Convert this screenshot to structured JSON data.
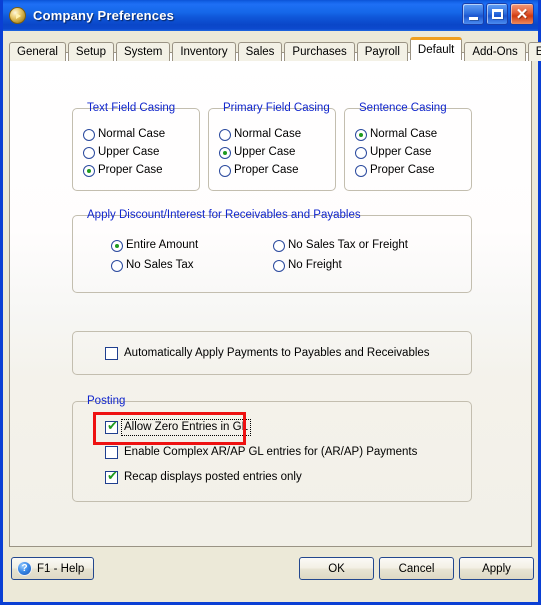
{
  "window": {
    "title": "Company Preferences",
    "icon": "app-circle-icon",
    "controls": {
      "minimize": "minimize-icon",
      "maximize": "maximize-icon",
      "close": "close-icon"
    }
  },
  "tabs": [
    {
      "label": "General",
      "active": false
    },
    {
      "label": "Setup",
      "active": false
    },
    {
      "label": "System",
      "active": false
    },
    {
      "label": "Inventory",
      "active": false
    },
    {
      "label": "Sales",
      "active": false
    },
    {
      "label": "Purchases",
      "active": false
    },
    {
      "label": "Payroll",
      "active": false
    },
    {
      "label": "Default",
      "active": true
    },
    {
      "label": "Add-Ons",
      "active": false
    },
    {
      "label": "Email Setup",
      "active": false
    }
  ],
  "groups": {
    "text_field_casing": {
      "label": "Text Field Casing",
      "options": [
        {
          "label": "Normal Case",
          "selected": false
        },
        {
          "label": "Upper Case",
          "selected": false
        },
        {
          "label": "Proper Case",
          "selected": true
        }
      ]
    },
    "primary_field_casing": {
      "label": "Primary Field Casing",
      "options": [
        {
          "label": "Normal Case",
          "selected": false
        },
        {
          "label": "Upper Case",
          "selected": true
        },
        {
          "label": "Proper Case",
          "selected": false
        }
      ]
    },
    "sentence_casing": {
      "label": "Sentence Casing",
      "options": [
        {
          "label": "Normal Case",
          "selected": true
        },
        {
          "label": "Upper Case",
          "selected": false
        },
        {
          "label": "Proper Case",
          "selected": false
        }
      ]
    },
    "apply_discount": {
      "label": "Apply Discount/Interest for Receivables and Payables",
      "options_left": [
        {
          "label": "Entire Amount",
          "selected": true
        },
        {
          "label": "No Sales Tax",
          "selected": false
        }
      ],
      "options_right": [
        {
          "label": "No Sales Tax or Freight",
          "selected": false
        },
        {
          "label": "No Freight",
          "selected": false
        }
      ]
    },
    "auto_apply": {
      "label": "",
      "checkbox": {
        "label": "Automatically Apply Payments to Payables and Receivables",
        "checked": false
      }
    },
    "posting": {
      "label": "Posting",
      "checkboxes": [
        {
          "label": "Allow Zero Entries in GL",
          "checked": true,
          "focused": true,
          "highlighted": true
        },
        {
          "label": "Enable Complex AR/AP  GL entries for (AR/AP)  Payments",
          "checked": false,
          "focused": false,
          "highlighted": false
        },
        {
          "label": "Recap displays posted entries only",
          "checked": true,
          "focused": false,
          "highlighted": false
        }
      ]
    }
  },
  "footer": {
    "help_label": "F1 - Help",
    "help_icon": "question-mark-icon",
    "ok_label": "OK",
    "cancel_label": "Cancel",
    "apply_label": "Apply"
  },
  "colors": {
    "titlebar_blue": "#0f56d8",
    "group_label_blue": "#1126cc",
    "radio_check_green": "#1f9a1f",
    "annotation_red": "#ee1111",
    "active_tab_top": "#f0a020"
  }
}
